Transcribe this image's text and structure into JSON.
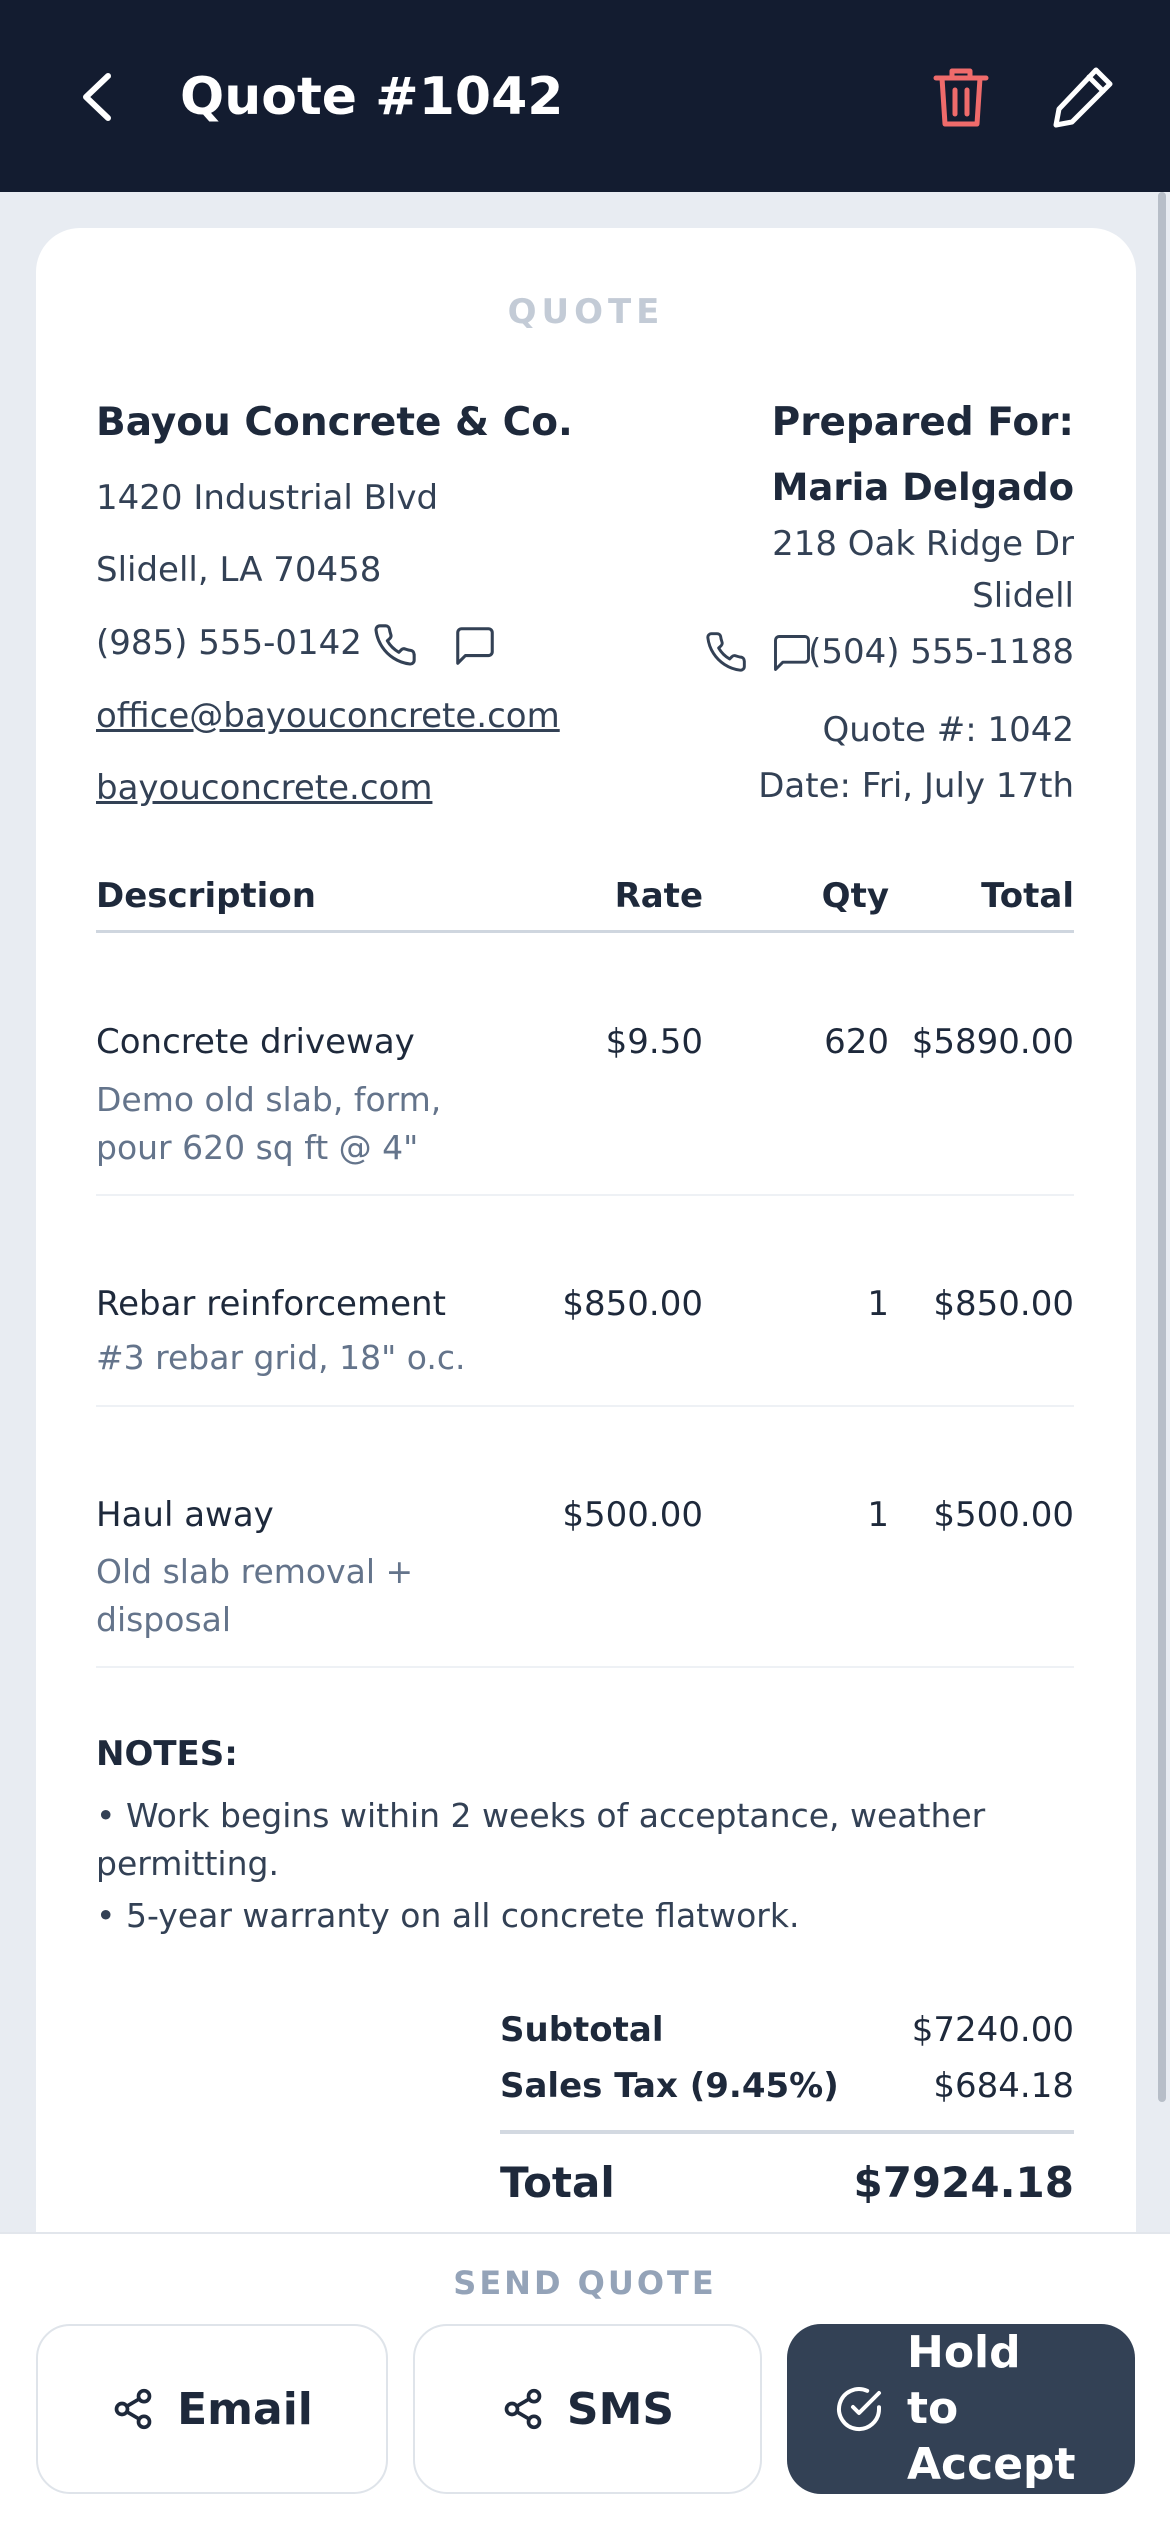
{
  "header": {
    "title": "Quote #1042",
    "back_icon": "chevron-left-icon",
    "delete_icon": "trash-icon",
    "edit_icon": "pencil-icon",
    "delete_color": "#ef6b6b",
    "background": "#131c30"
  },
  "document": {
    "label": "QUOTE",
    "business": {
      "name": "Bayou Concrete & Co.",
      "address_line1": "1420 Industrial Blvd",
      "address_line2": "Slidell, LA 70458",
      "phone": "(985) 555-0142",
      "email": "office@bayouconcrete.com",
      "website": "bayouconcrete.com"
    },
    "client": {
      "prepared_for_label": "Prepared For:",
      "name": "Maria Delgado",
      "address_line1": "218 Oak Ridge Dr",
      "address_line2": "Slidell",
      "phone": "(504) 555-1188"
    },
    "quote_number": "Quote #: 1042",
    "date": "Date: Fri, July 17th",
    "columns": {
      "description": "Description",
      "rate": "Rate",
      "qty": "Qty",
      "total": "Total"
    },
    "line_items": [
      {
        "title": "Concrete driveway",
        "desc_line1": "Demo old slab, form,",
        "desc_line2": "pour 620 sq ft @ 4\"",
        "rate": "$9.50",
        "qty": "620",
        "total": "$5890.00"
      },
      {
        "title": "Rebar reinforcement",
        "desc_line1": "#3 rebar grid, 18\" o.c.",
        "desc_line2": "",
        "rate": "$850.00",
        "qty": "1",
        "total": "$850.00"
      },
      {
        "title": "Haul away",
        "desc_line1": "Old slab removal +",
        "desc_line2": "disposal",
        "rate": "$500.00",
        "qty": "1",
        "total": "$500.00"
      }
    ],
    "notes": {
      "title": "NOTES:",
      "items": [
        "• Work begins within 2 weeks of acceptance, weather permitting.",
        "• 5-year warranty on all concrete flatwork."
      ]
    },
    "totals": {
      "subtotal_label": "Subtotal",
      "subtotal": "$7240.00",
      "tax_label": "Sales Tax (9.45%)",
      "tax": "$684.18",
      "total_label": "Total",
      "total": "$7924.18"
    }
  },
  "footer": {
    "send_label": "SEND QUOTE",
    "email_label": "Email",
    "sms_label": "SMS",
    "accept_line1": "Hold to",
    "accept_line2": "Accept",
    "share_icon": "share-icon",
    "accept_icon": "check-circle-icon",
    "accept_color": "#334155"
  }
}
